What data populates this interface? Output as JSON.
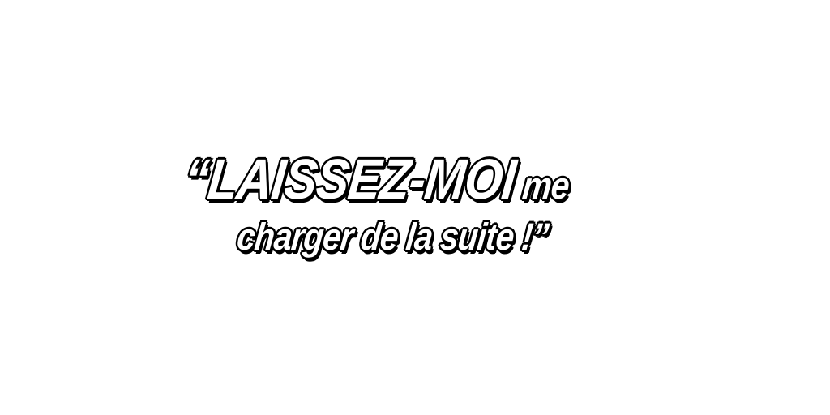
{
  "quote": {
    "line1_main": "“LAISSEZ-MOI",
    "line1_tail": " me",
    "line2": "charger de la suite !”"
  },
  "colors": {
    "background": "#ffffff",
    "text_fill": "#ffffff",
    "text_outline": "#000000"
  }
}
